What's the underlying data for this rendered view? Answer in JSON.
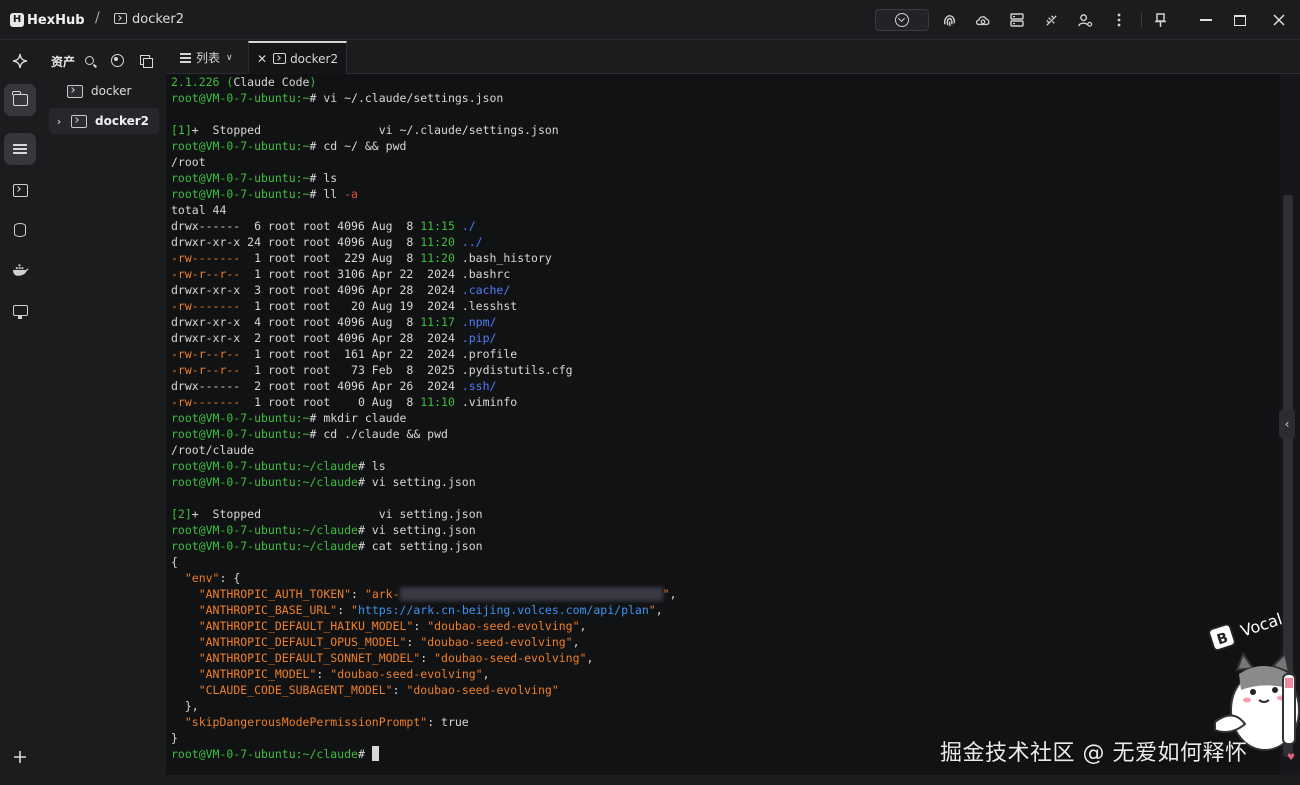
{
  "app": {
    "name": "HexHub",
    "breadcrumb_sep": "/",
    "current_host": "docker2"
  },
  "titlebar_icons": [
    "download-circle-icon",
    "fingerprint-icon",
    "cloud-sync-icon",
    "server-icon",
    "disconnect-icon",
    "user-settings-icon",
    "more-vertical-icon",
    "pin-icon",
    "minimize-icon",
    "maximize-icon",
    "close-icon"
  ],
  "assets": {
    "title": "资产",
    "items": [
      {
        "label": "docker"
      },
      {
        "label": "docker2"
      }
    ]
  },
  "tabs": {
    "list_label": "列表",
    "active_tab": "docker2"
  },
  "terminal": {
    "lines": [
      [
        {
          "t": "2.1.226 (",
          "c": "g"
        },
        {
          "t": "Claude Code"
        },
        {
          "t": ")",
          "c": "g"
        }
      ],
      [
        {
          "t": "root@VM-0-7-ubuntu:~",
          "c": "g"
        },
        {
          "t": "# vi ~/.claude/settings.json"
        }
      ],
      [
        {
          "t": ""
        }
      ],
      [
        {
          "t": "[1]",
          "c": "g"
        },
        {
          "t": "+  Stopped                 vi ~/.claude/settings.json"
        }
      ],
      [
        {
          "t": "root@VM-0-7-ubuntu:~",
          "c": "g"
        },
        {
          "t": "# cd ~/ && pwd"
        }
      ],
      [
        {
          "t": "/root"
        }
      ],
      [
        {
          "t": "root@VM-0-7-ubuntu:~",
          "c": "g"
        },
        {
          "t": "# ls"
        }
      ],
      [
        {
          "t": "root@VM-0-7-ubuntu:~",
          "c": "g"
        },
        {
          "t": "# ll "
        },
        {
          "t": "-a",
          "c": "r"
        }
      ],
      [
        {
          "t": "total 44"
        }
      ],
      [
        {
          "t": "drwx------  6 root root 4096 Aug  8 "
        },
        {
          "t": "11:15",
          "c": "g"
        },
        {
          "t": " "
        },
        {
          "t": "./",
          "c": "b"
        }
      ],
      [
        {
          "t": "drwxr-xr-x 24 root root 4096 Aug  8 "
        },
        {
          "t": "11:20",
          "c": "g"
        },
        {
          "t": " "
        },
        {
          "t": "../",
          "c": "b"
        }
      ],
      [
        {
          "t": "-rw-------",
          "c": "o"
        },
        {
          "t": "  1 root root  229 Aug  8 "
        },
        {
          "t": "11:20",
          "c": "g"
        },
        {
          "t": " .bash_history"
        }
      ],
      [
        {
          "t": "-rw-r--r--",
          "c": "o"
        },
        {
          "t": "  1 root root 3106 Apr 22  2024 .bashrc"
        }
      ],
      [
        {
          "t": "drwxr-xr-x  3 root root 4096 Apr 28  2024 "
        },
        {
          "t": ".cache/",
          "c": "b"
        }
      ],
      [
        {
          "t": "-rw-------",
          "c": "o"
        },
        {
          "t": "  1 root root   20 Aug 19  2024 .lesshst"
        }
      ],
      [
        {
          "t": "drwxr-xr-x  4 root root 4096 Aug  8 "
        },
        {
          "t": "11:17",
          "c": "g"
        },
        {
          "t": " "
        },
        {
          "t": ".npm/",
          "c": "b"
        }
      ],
      [
        {
          "t": "drwxr-xr-x  2 root root 4096 Apr 28  2024 "
        },
        {
          "t": ".pip/",
          "c": "b"
        }
      ],
      [
        {
          "t": "-rw-r--r--",
          "c": "o"
        },
        {
          "t": "  1 root root  161 Apr 22  2024 .profile"
        }
      ],
      [
        {
          "t": "-rw-r--r--",
          "c": "o"
        },
        {
          "t": "  1 root root   73 Feb  8  2025 .pydistutils.cfg"
        }
      ],
      [
        {
          "t": "drwx------  2 root root 4096 Apr 26  2024 "
        },
        {
          "t": ".ssh/",
          "c": "b"
        }
      ],
      [
        {
          "t": "-rw-------",
          "c": "o"
        },
        {
          "t": "  1 root root    0 Aug  8 "
        },
        {
          "t": "11:10",
          "c": "g"
        },
        {
          "t": " .viminfo"
        }
      ],
      [
        {
          "t": "root@VM-0-7-ubuntu:~",
          "c": "g"
        },
        {
          "t": "# mkdir claude"
        }
      ],
      [
        {
          "t": "root@VM-0-7-ubuntu:~",
          "c": "g"
        },
        {
          "t": "# cd ./claude && pwd"
        }
      ],
      [
        {
          "t": "/root/claude"
        }
      ],
      [
        {
          "t": "root@VM-0-7-ubuntu:~/claude",
          "c": "g"
        },
        {
          "t": "# ls"
        }
      ],
      [
        {
          "t": "root@VM-0-7-ubuntu:~/claude",
          "c": "g"
        },
        {
          "t": "# vi setting.json"
        }
      ],
      [
        {
          "t": ""
        }
      ],
      [
        {
          "t": "[2]",
          "c": "g"
        },
        {
          "t": "+  Stopped                 vi setting.json"
        }
      ],
      [
        {
          "t": "root@VM-0-7-ubuntu:~/claude",
          "c": "g"
        },
        {
          "t": "# vi setting.json"
        }
      ],
      [
        {
          "t": "root@VM-0-7-ubuntu:~/claude",
          "c": "g"
        },
        {
          "t": "# cat setting.json"
        }
      ],
      [
        {
          "t": "{"
        }
      ],
      [
        {
          "t": "  "
        },
        {
          "t": "\"env\"",
          "c": "o"
        },
        {
          "t": ": {"
        }
      ],
      [
        {
          "t": "    "
        },
        {
          "t": "\"ANTHROPIC_AUTH_TOKEN\"",
          "c": "o"
        },
        {
          "t": ": "
        },
        {
          "t": "\"ark-",
          "c": "o"
        },
        {
          "t": "xxxxxxxx-xxxx-xxxx-xxxx-xxxxxxxx-xxxxx",
          "c": "blur"
        },
        {
          "t": "\"",
          "c": "o"
        },
        {
          "t": ","
        }
      ],
      [
        {
          "t": "    "
        },
        {
          "t": "\"ANTHROPIC_BASE_URL\"",
          "c": "o"
        },
        {
          "t": ": "
        },
        {
          "t": "\"",
          "c": "o"
        },
        {
          "t": "https://ark.cn-beijing.volces.com/api/plan",
          "c": "u"
        },
        {
          "t": "\"",
          "c": "o"
        },
        {
          "t": ","
        }
      ],
      [
        {
          "t": "    "
        },
        {
          "t": "\"ANTHROPIC_DEFAULT_HAIKU_MODEL\"",
          "c": "o"
        },
        {
          "t": ": "
        },
        {
          "t": "\"doubao-seed-evolving\"",
          "c": "o"
        },
        {
          "t": ","
        }
      ],
      [
        {
          "t": "    "
        },
        {
          "t": "\"ANTHROPIC_DEFAULT_OPUS_MODEL\"",
          "c": "o"
        },
        {
          "t": ": "
        },
        {
          "t": "\"doubao-seed-evolving\"",
          "c": "o"
        },
        {
          "t": ","
        }
      ],
      [
        {
          "t": "    "
        },
        {
          "t": "\"ANTHROPIC_DEFAULT_SONNET_MODEL\"",
          "c": "o"
        },
        {
          "t": ": "
        },
        {
          "t": "\"doubao-seed-evolving\"",
          "c": "o"
        },
        {
          "t": ","
        }
      ],
      [
        {
          "t": "    "
        },
        {
          "t": "\"ANTHROPIC_MODEL\"",
          "c": "o"
        },
        {
          "t": ": "
        },
        {
          "t": "\"doubao-seed-evolving\"",
          "c": "o"
        },
        {
          "t": ","
        }
      ],
      [
        {
          "t": "    "
        },
        {
          "t": "\"CLAUDE_CODE_SUBAGENT_MODEL\"",
          "c": "o"
        },
        {
          "t": ": "
        },
        {
          "t": "\"doubao-seed-evolving\"",
          "c": "o"
        }
      ],
      [
        {
          "t": "  },"
        }
      ],
      [
        {
          "t": "  "
        },
        {
          "t": "\"skipDangerousModePermissionPrompt\"",
          "c": "o"
        },
        {
          "t": ": true"
        }
      ],
      [
        {
          "t": "}"
        }
      ],
      [
        {
          "t": "root@VM-0-7-ubuntu:~/claude",
          "c": "g"
        },
        {
          "t": "# "
        },
        {
          "t": "",
          "c": "cursor"
        }
      ]
    ]
  },
  "watermark": "掘金技术社区 @ 无爱如何释怀",
  "sticker_text": "Vocal",
  "colors": {
    "prompt_green": "#3fbf3f",
    "json_key_orange": "#f07f25",
    "url_blue": "#3d93f2",
    "dir_blue": "#4f7dfa",
    "flag_red": "#e84c3d"
  }
}
